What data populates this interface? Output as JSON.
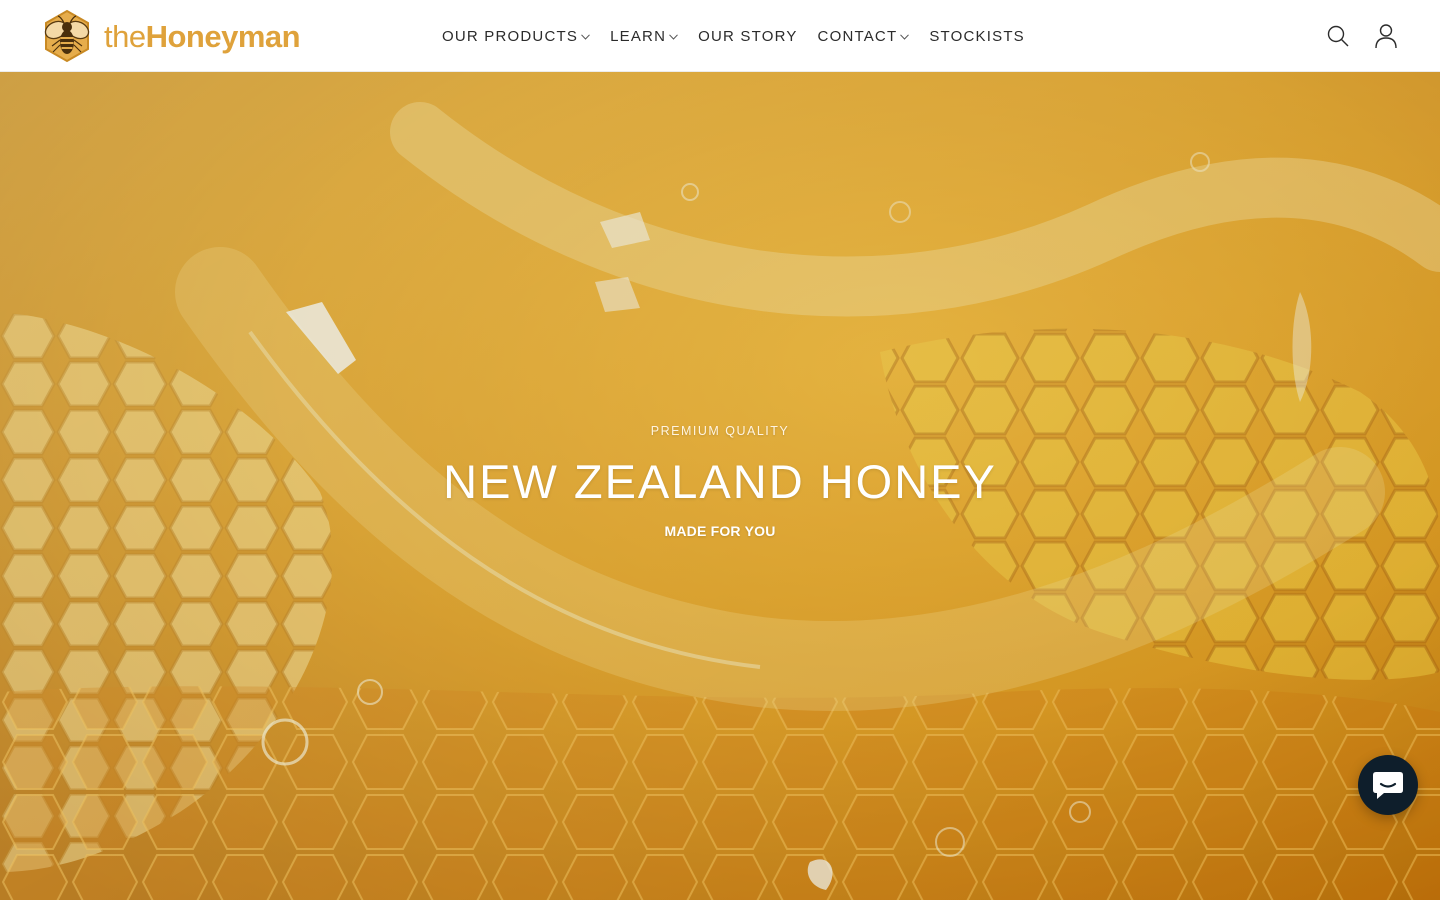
{
  "brand": {
    "name_prefix": "the",
    "name_main": "Honeyman",
    "logo_icon": "bee-hexagon-icon",
    "color": "#dfa23b"
  },
  "nav": {
    "items": [
      {
        "label": "OUR PRODUCTS",
        "has_dropdown": true
      },
      {
        "label": "LEARN",
        "has_dropdown": true
      },
      {
        "label": "OUR STORY",
        "has_dropdown": false
      },
      {
        "label": "CONTACT",
        "has_dropdown": true
      },
      {
        "label": "STOCKISTS",
        "has_dropdown": false
      }
    ]
  },
  "header_icons": [
    "search-icon",
    "account-icon"
  ],
  "hero": {
    "eyebrow": "PREMIUM QUALITY",
    "title": "NEW ZEALAND HONEY",
    "subtitle": "MADE FOR YOU",
    "background": "honeycomb-image",
    "tint": "#d98a10"
  },
  "chat": {
    "icon": "chat-icon",
    "color": "#0e1e2b"
  }
}
